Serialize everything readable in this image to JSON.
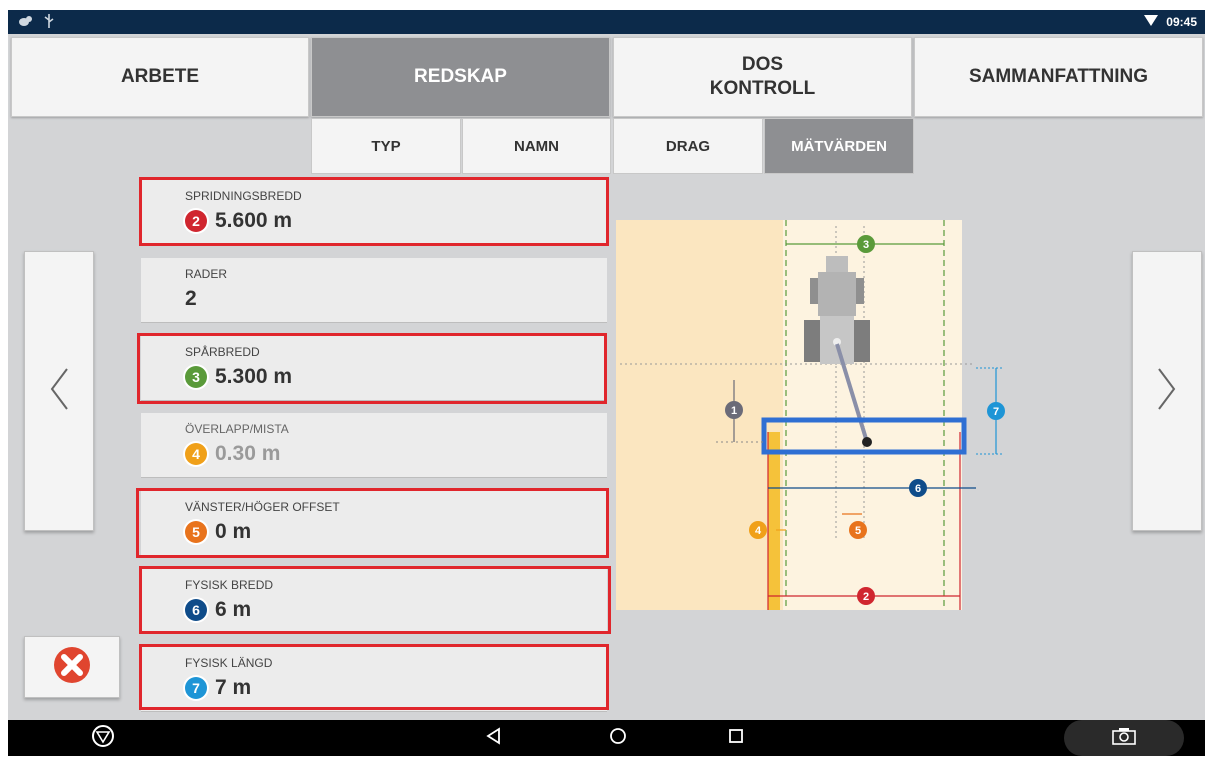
{
  "statusbar": {
    "time": "09:45"
  },
  "tabs": [
    {
      "label": "ARBETE"
    },
    {
      "label": "REDSKAP"
    },
    {
      "line1": "DOS",
      "line2": "KONTROLL"
    },
    {
      "label": "SAMMANFATTNING"
    }
  ],
  "subtabs": [
    "TYP",
    "NAMN",
    "DRAG",
    "MÄTVÄRDEN"
  ],
  "fields": [
    {
      "label": "SPRIDNINGSBREDD",
      "badge": "2",
      "value": "5.600 m"
    },
    {
      "label": "RADER",
      "value": "2"
    },
    {
      "label": "SPÅRBREDD",
      "badge": "3",
      "value": "5.300 m"
    },
    {
      "label": "ÖVERLAPP/MISTA",
      "badge": "4",
      "value": "0.30 m"
    },
    {
      "label": "VÄNSTER/HÖGER OFFSET",
      "badge": "5",
      "value": "0 m"
    },
    {
      "label": "FYSISK BREDD",
      "badge": "6",
      "value": "6 m"
    },
    {
      "label": "FYSISK LÄNGD",
      "badge": "7",
      "value": "7 m"
    }
  ],
  "diagram_labels": [
    "1",
    "2",
    "3",
    "4",
    "5",
    "6",
    "7"
  ],
  "colors": {
    "badge1": "#6b6b78",
    "badge2": "#d0262f",
    "badge3": "#5a9a3a",
    "badge4": "#f0a019",
    "badge5": "#e8731c",
    "badge6": "#0f4c8a",
    "badge7": "#1e95d6",
    "highlight": "#e0262c",
    "active_tab": "#8e8f92",
    "status_bar": "#0c2a4a"
  },
  "icons": {
    "prev": "chevron-left-icon",
    "next": "chevron-right-icon",
    "close": "close-red-icon",
    "back": "back-triangle-icon",
    "home": "home-circle-icon",
    "recents": "recents-square-icon",
    "camera": "camera-icon",
    "menu": "down-triangle-circle-icon"
  }
}
